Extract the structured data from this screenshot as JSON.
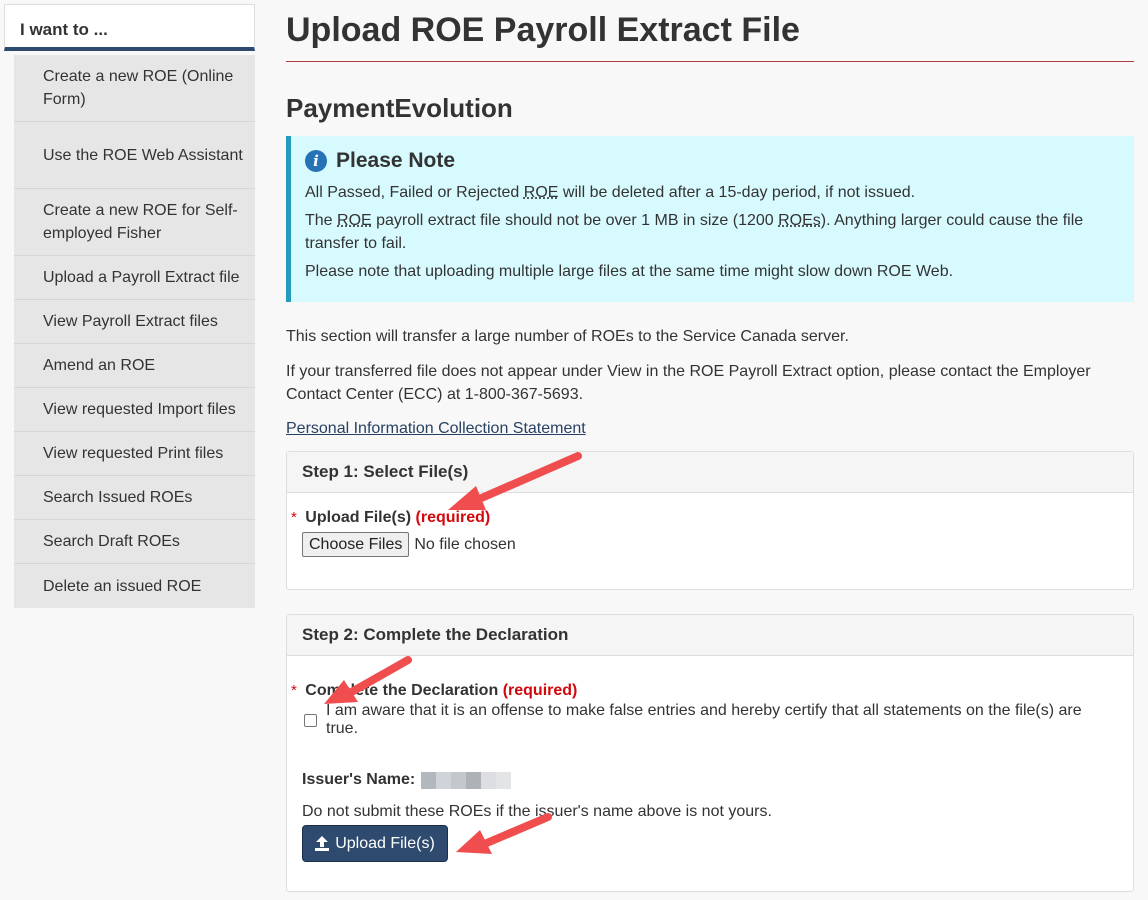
{
  "sidebar": {
    "heading": "I want to ...",
    "items": [
      {
        "label": "Create a new ROE (Online Form)",
        "lines": 2
      },
      {
        "label": "Use the ROE Web Assistant",
        "lines": 2
      },
      {
        "label": "Create a new ROE for Self-employed Fisher",
        "lines": 2
      },
      {
        "label": "Upload a Payroll Extract file",
        "lines": 1
      },
      {
        "label": "View Payroll Extract files",
        "lines": 1
      },
      {
        "label": "Amend an ROE",
        "lines": 1
      },
      {
        "label": "View requested Import files",
        "lines": 1
      },
      {
        "label": "View requested Print files",
        "lines": 1
      },
      {
        "label": "Search Issued ROEs",
        "lines": 1
      },
      {
        "label": "Search Draft ROEs",
        "lines": 1
      },
      {
        "label": "Delete an issued ROE",
        "lines": 1
      }
    ]
  },
  "page": {
    "title": "Upload ROE Payroll Extract File",
    "org": "PaymentEvolution"
  },
  "note": {
    "heading": "Please Note",
    "line1_a": "All Passed, Failed or Rejected ",
    "line1_abbr": "ROE",
    "line1_b": " will be deleted after a 15-day period, if not issued.",
    "line2_a": "The ",
    "line2_abbr1": "ROE",
    "line2_b": " payroll extract file should not be over 1 MB in size (1200 ",
    "line2_abbr2": "ROEs",
    "line2_c": "). Anything larger could cause the file transfer to fail.",
    "line3": "Please note that uploading multiple large files at the same time might slow down ROE Web."
  },
  "body": {
    "para1": "This section will transfer a large number of ROEs to the Service Canada server.",
    "para2": "If your transferred file does not appear under View in the ROE Payroll Extract option, please contact the Employer Contact Center (ECC) at 1-800-367-5693.",
    "privacy_link": "Personal Information Collection Statement"
  },
  "step1": {
    "heading": "Step 1: Select File(s)",
    "star": "*",
    "label": "Upload File(s)",
    "required": "(required)",
    "choose_button": "Choose Files",
    "file_status": "No file chosen"
  },
  "step2": {
    "heading": "Step 2: Complete the Declaration",
    "star": "*",
    "label": "Complete the Declaration",
    "required": "(required)",
    "checkbox_text": "I am aware that it is an offense to make false entries and hereby certify that all statements on the file(s) are true.",
    "checkbox_checked": false,
    "issuer_label": "Issuer's Name:",
    "warning": "Do not submit these ROEs if the issuer's name above is not yours.",
    "upload_button": "Upload File(s)"
  },
  "colors": {
    "sidebar_accent": "#2e4a6e",
    "title_rule": "#af3c43",
    "note_bg": "#d7faff",
    "note_border": "#269abc",
    "required": "#d3080c",
    "button": "#2e4a6e",
    "annotation_arrow": "#f04e4e"
  },
  "icons": {
    "info": "info-icon",
    "upload": "upload-icon",
    "annotation": "red-arrow-icon"
  }
}
